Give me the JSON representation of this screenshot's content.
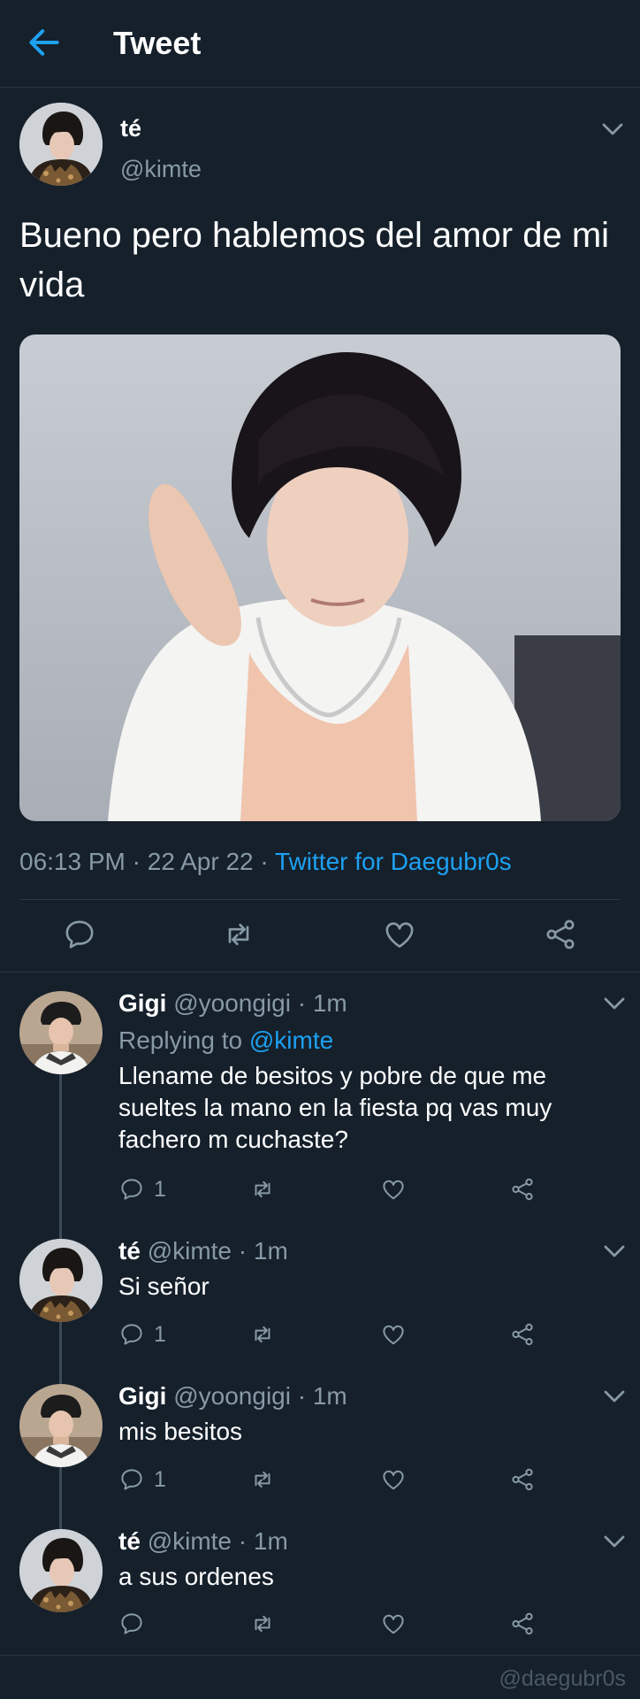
{
  "header": {
    "title": "Tweet"
  },
  "tweet": {
    "name": "té",
    "handle": "@kimte",
    "text": "Bueno pero hablemos del amor de mi vida",
    "time": "06:13 PM",
    "date": "22 Apr 22",
    "source": "Twitter for Daegubr0s"
  },
  "replies": [
    {
      "name": "Gigi",
      "handle": "@yoongigi",
      "time": "1m",
      "replying_label": "Replying to",
      "replying_to": "@kimte",
      "text": "Llename de besitos y pobre de que me sueltes la mano en la fiesta pq vas muy fachero m cuchaste?",
      "reply_count": "1"
    },
    {
      "name": "té",
      "handle": "@kimte",
      "time": "1m",
      "text": "Si señor",
      "reply_count": "1"
    },
    {
      "name": "Gigi",
      "handle": "@yoongigi",
      "time": "1m",
      "text": "mis besitos",
      "reply_count": "1"
    },
    {
      "name": "té",
      "handle": "@kimte",
      "time": "1m",
      "text": "a sus ordenes",
      "reply_count": ""
    }
  ],
  "watermark": "@daegubr0s",
  "colors": {
    "background": "#15202b",
    "accent": "#1da1f2",
    "muted": "#8899a6",
    "divider": "#2c3640"
  },
  "icons": [
    "back-arrow-icon",
    "chevron-down-icon",
    "reply-icon",
    "retweet-icon",
    "like-icon",
    "share-icon"
  ]
}
